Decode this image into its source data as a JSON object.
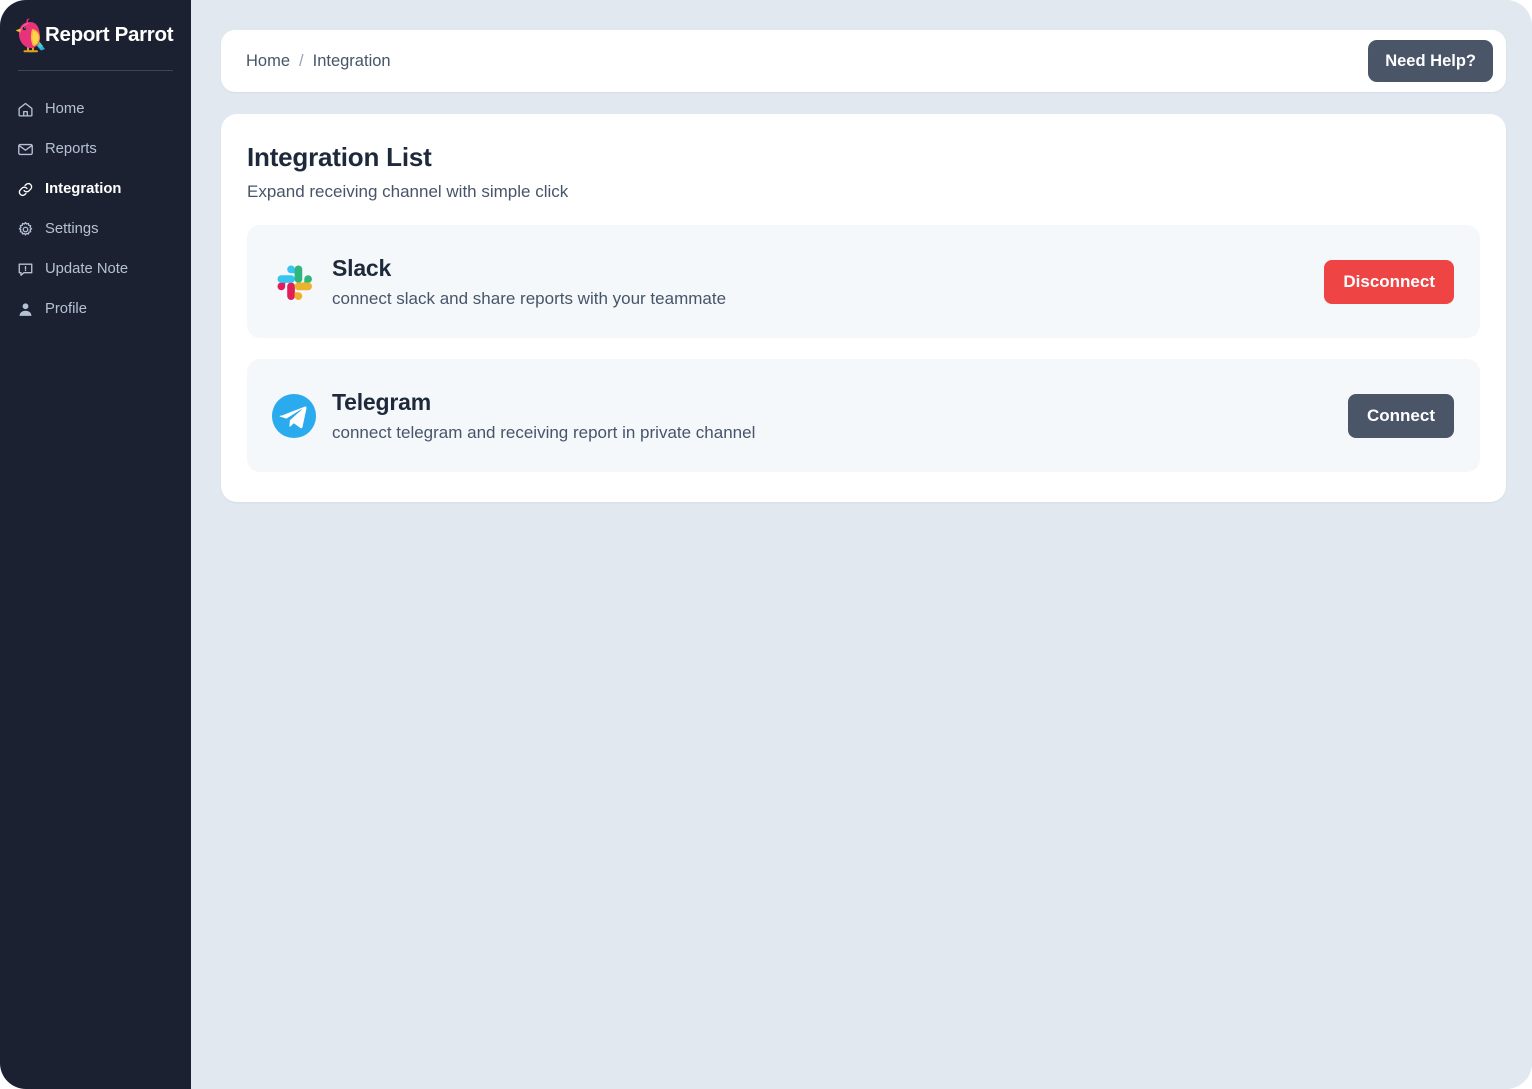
{
  "brand": {
    "name": "Report Parrot",
    "logo_icon": "parrot-logo-icon"
  },
  "sidebar": {
    "items": [
      {
        "label": "Home",
        "icon": "home-icon",
        "active": false
      },
      {
        "label": "Reports",
        "icon": "mail-icon",
        "active": false
      },
      {
        "label": "Integration",
        "icon": "link-icon",
        "active": true
      },
      {
        "label": "Settings",
        "icon": "gear-icon",
        "active": false
      },
      {
        "label": "Update Note",
        "icon": "message-alert-icon",
        "active": false
      },
      {
        "label": "Profile",
        "icon": "user-icon",
        "active": false
      }
    ]
  },
  "topbar": {
    "breadcrumb": {
      "home": "Home",
      "separator": "/",
      "current": "Integration"
    },
    "help_label": "Need Help?"
  },
  "panel": {
    "title": "Integration List",
    "subtitle": "Expand receiving channel with simple click",
    "integrations": [
      {
        "name": "Slack",
        "description": "connect slack and share reports with your teammate",
        "logo_icon": "slack-logo-icon",
        "action_label": "Disconnect",
        "action_style": "danger"
      },
      {
        "name": "Telegram",
        "description": "connect telegram and receiving report in private channel",
        "logo_icon": "telegram-logo-icon",
        "action_label": "Connect",
        "action_style": "neutral"
      }
    ]
  },
  "colors": {
    "sidebar_bg": "#1B2130",
    "page_bg": "#E2E8F0",
    "card_bg": "#FFFFFF",
    "row_bg": "#F5F8FB",
    "neutral_button": "#4A5568",
    "danger_button": "#EF4444",
    "slack_cyan": "#36C5F0",
    "slack_green": "#2EB67D",
    "slack_red": "#E01E5A",
    "slack_yellow": "#ECB22E",
    "telegram_blue": "#2AABEE"
  }
}
